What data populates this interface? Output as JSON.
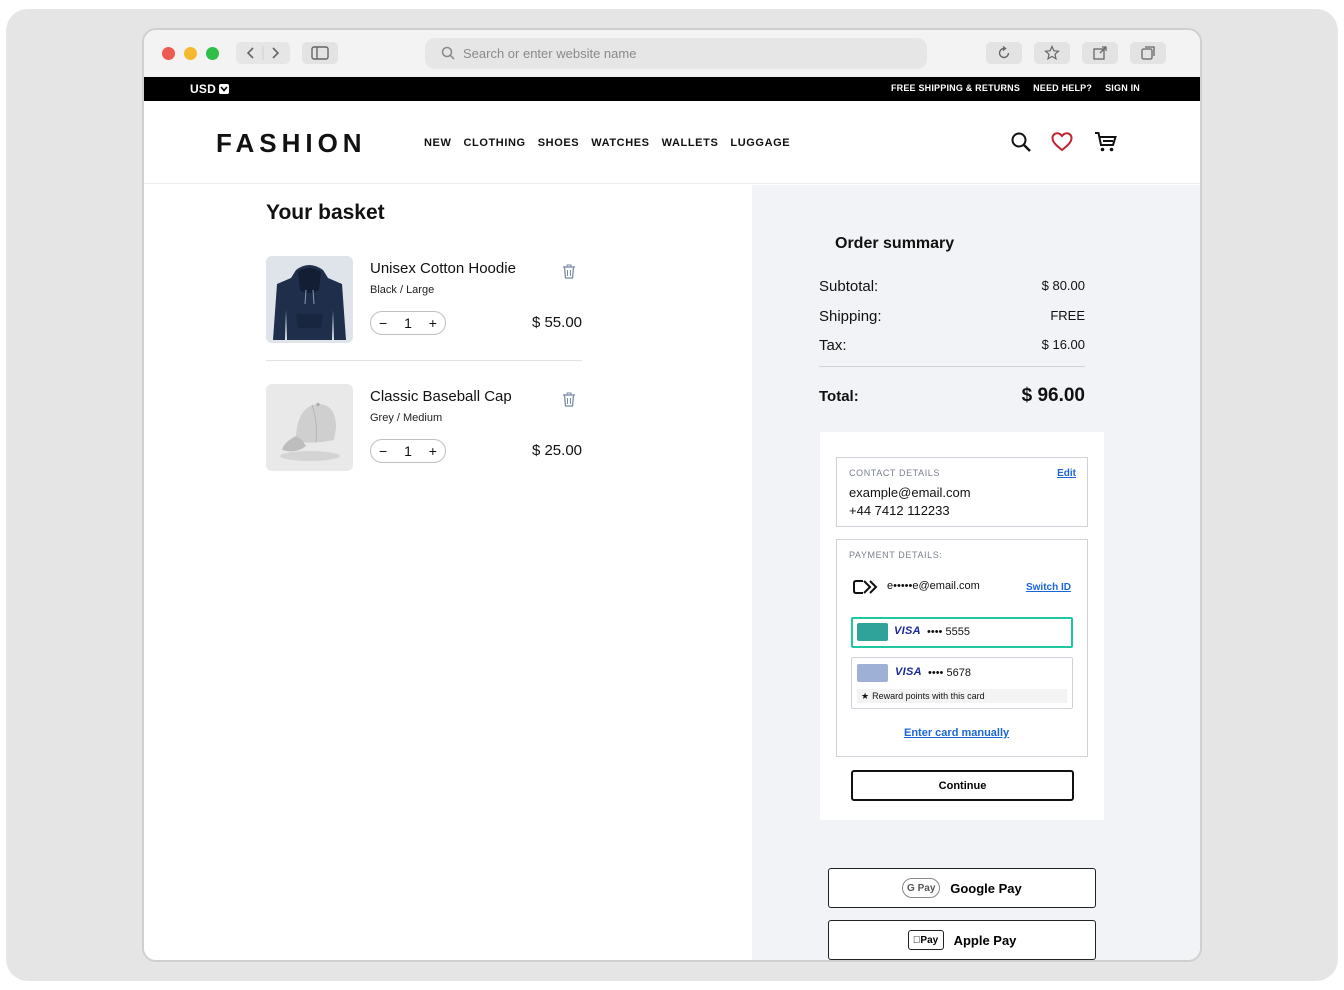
{
  "browser": {
    "url_placeholder": "Search or enter website name"
  },
  "topbar": {
    "currency": "USD",
    "links": [
      "FREE SHIPPING & RETURNS",
      "NEED HELP?",
      "SIGN IN"
    ]
  },
  "header": {
    "logo": "FASHION",
    "nav": [
      "NEW",
      "CLOTHING",
      "SHOES",
      "WATCHES",
      "WALLETS",
      "LUGGAGE"
    ],
    "icons": [
      "search-icon",
      "heart-icon",
      "cart-icon"
    ],
    "heart_color": "#c0242f"
  },
  "basket": {
    "title": "Your basket",
    "items": [
      {
        "name": "Unisex Cotton Hoodie",
        "variant": "Black / Large",
        "quantity": "1",
        "price": "$ 55.00"
      },
      {
        "name": "Classic Baseball Cap",
        "variant": "Grey / Medium",
        "quantity": "1",
        "price": "$ 25.00"
      }
    ]
  },
  "summary": {
    "title": "Order summary",
    "rows": [
      {
        "label": "Subtotal:",
        "value": "$ 80.00"
      },
      {
        "label": "Shipping:",
        "value": "FREE"
      },
      {
        "label": "Tax:",
        "value": "$ 16.00"
      }
    ],
    "total_label": "Total:",
    "total_value": "$ 96.00"
  },
  "checkout": {
    "contact": {
      "label": "CONTACT DETAILS",
      "edit": "Edit",
      "email": "example@email.com",
      "phone": "+44 7412 112233"
    },
    "payment": {
      "label": "PAYMENT DETAILS:",
      "account": "e•••••e@email.com",
      "switch": "Switch ID",
      "cards": [
        {
          "brand": "VISA",
          "last4": "•••• 5555",
          "selected": true,
          "color": "#2fa39a"
        },
        {
          "brand": "VISA",
          "last4": "•••• 5678",
          "selected": false,
          "color": "#9fb0d6",
          "note": "Reward points with this card"
        }
      ],
      "manual": "Enter card manually"
    },
    "continue": "Continue"
  },
  "wallets": {
    "google": {
      "badge": "G Pay",
      "label": "Google Pay"
    },
    "apple": {
      "badge": "Pay",
      "label": "Apple Pay"
    }
  },
  "colors": {
    "accent": "#1fc7a0",
    "link": "#1a66d6",
    "summary_bg": "#f2f3f6"
  }
}
